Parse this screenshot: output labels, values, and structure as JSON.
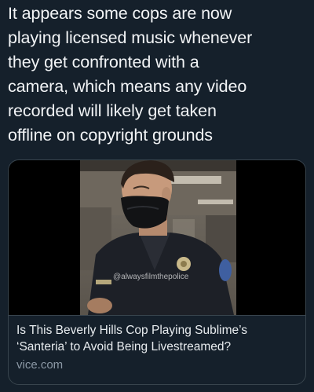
{
  "tweet": {
    "text": "It appears some cops are now\nplaying licensed music whenever\nthey get confronted with a\ncamera, which means any video\nrecorded will likely get taken\noffline on copyright grounds"
  },
  "link_card": {
    "title": "Is This Beverly Hills Cop Playing Sublime’s\n‘Santeria’ to Avoid Being Livestreamed?",
    "domain": "vice.com",
    "video_watermark": "@alwaysfilmthepolice"
  },
  "colors": {
    "background": "#15202b",
    "card_border": "#38444d",
    "secondary_text": "#8b98a5"
  }
}
